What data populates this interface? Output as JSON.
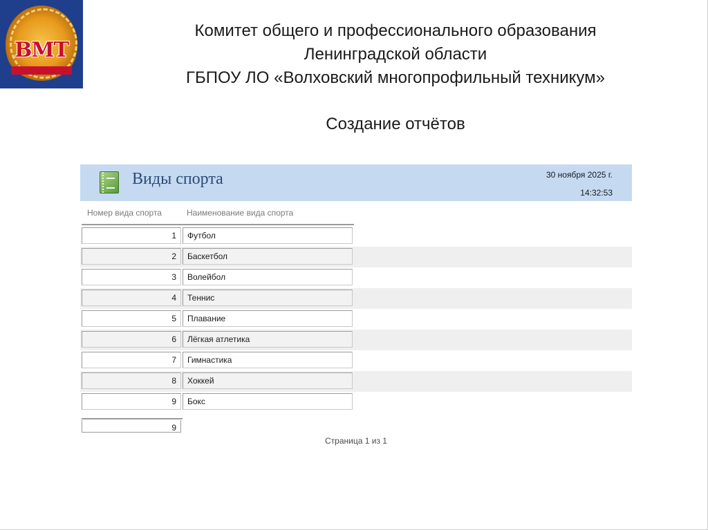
{
  "header": {
    "line1": "Комитет общего и профессионального образования",
    "line2": "Ленинградской области",
    "line3": "ГБПОУ ЛО  «Волховский многопрофильный техникум»"
  },
  "logo": {
    "icon": "college-emblem-icon",
    "text": "ВМТ"
  },
  "section_title": "Создание отчётов",
  "report": {
    "title": "Виды спорта",
    "icon": "report-icon",
    "date": "30 ноября 2025 г.",
    "time": "14:32:53",
    "columns": [
      "Номер вида спорта",
      "Наименование вида спорта"
    ],
    "rows": [
      {
        "num": "1",
        "name": "Футбол"
      },
      {
        "num": "2",
        "name": "Баскетбол"
      },
      {
        "num": "3",
        "name": "Волейбол"
      },
      {
        "num": "4",
        "name": "Теннис"
      },
      {
        "num": "5",
        "name": "Плавание"
      },
      {
        "num": "6",
        "name": "Лёгкая атлетика"
      },
      {
        "num": "7",
        "name": "Гимнастика"
      },
      {
        "num": "8",
        "name": "Хоккей"
      },
      {
        "num": "9",
        "name": "Бокс"
      }
    ],
    "total": "9",
    "page_label": "Страница 1 из 1"
  }
}
